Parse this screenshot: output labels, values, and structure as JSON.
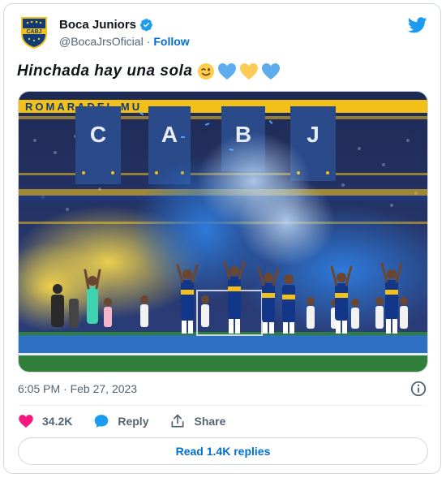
{
  "tweet": {
    "author_name": "Boca Juniors",
    "handle": "@BocaJrsOficial",
    "separator": "·",
    "follow_label": "Follow",
    "text": "Hinchada hay una sola",
    "emojis": [
      "winking-face",
      "blue-heart",
      "yellow-heart",
      "blue-heart"
    ],
    "timestamp": "6:05 PM · Feb 27, 2023",
    "actions": {
      "likes": "34.2K",
      "reply_label": "Reply",
      "share_label": "Share"
    },
    "read_replies_label": "Read 1.4K replies"
  },
  "media": {
    "banner_text": "ROMARADEL MU",
    "flags": [
      "C",
      "A",
      "B",
      "J"
    ],
    "crest_text": "CABJ"
  },
  "colors": {
    "accent_blue": "#006fd6",
    "twitter_blue": "#1d9bf0",
    "heart_pink": "#f91880",
    "boca_blue": "#0f3b7a",
    "boca_gold": "#f2c019"
  }
}
